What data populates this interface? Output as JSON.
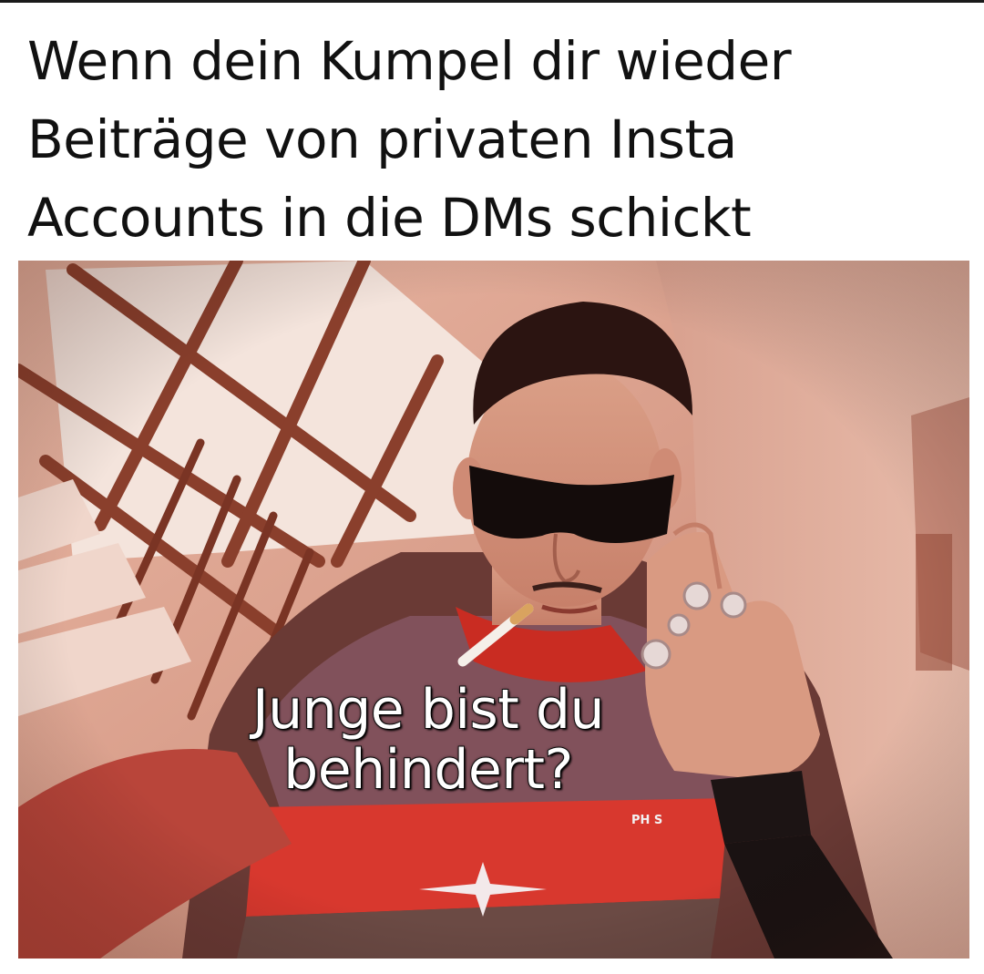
{
  "meme": {
    "caption_lines": [
      "Wenn dein Kumpel dir wieder",
      "Beiträge von privaten Insta",
      "Accounts in die DMs schickt"
    ],
    "overlay_lines": [
      "Junge bist du",
      "behindert?"
    ],
    "shirt_text": "PH  S"
  },
  "colors": {
    "caption_text": "#111111",
    "overlay_text": "#ffffff",
    "overlay_outline": "#111111",
    "photo_tint": "#c98a76"
  },
  "photo": {
    "description_icon": "person-with-sunglasses-and-cigarette"
  }
}
